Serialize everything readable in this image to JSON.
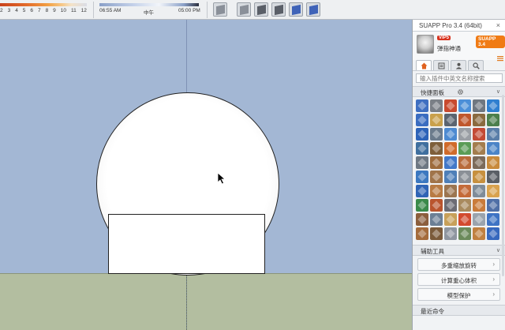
{
  "toolbar": {
    "months": [
      "2",
      "3",
      "4",
      "5",
      "6",
      "7",
      "8",
      "9",
      "10",
      "11",
      "12"
    ],
    "time_start": "06:55 AM",
    "time_mid": "中午",
    "time_end": "05:00 PM",
    "style_icons": [
      "xray-cube-icon",
      "wireframe-cube-icon",
      "hidden-line-cube-icon",
      "shaded-cube-icon",
      "shaded-texture-cube-icon",
      "monochrome-cube-icon"
    ]
  },
  "viewport": {
    "sky_color": "#a3b7d4",
    "ground_color": "#b3bea0",
    "model_color": "#ffffff"
  },
  "panel": {
    "title": "SUAPP Pro 3.4 (64bit)",
    "vip": "VIP5",
    "username": "弹指神通",
    "version": "SUAPP 3.4",
    "search_placeholder": "输入插件中英文名称搜索",
    "quick_panel_label": "快捷面板",
    "aux_tools_label": "辅助工具",
    "aux_buttons": [
      "多重缩放旋转",
      "计算重心体积",
      "模型保护"
    ],
    "recent_label": "最近命令",
    "tool_colors": [
      "#3f6fc1",
      "#7a7f86",
      "#c84a2f",
      "#4b8fd8",
      "#6f7780",
      "#2f7fd0",
      "#3a6cc0",
      "#c9a04b",
      "#5b6470",
      "#c0572d",
      "#8a6a3f",
      "#4c7f4c",
      "#2d63b8",
      "#6b7b8c",
      "#4d8ad1",
      "#9a9ea4",
      "#c34a35",
      "#5a7ea8",
      "#3f6f9e",
      "#7e5f3a",
      "#d06b2a",
      "#5a9c56",
      "#a37d4e",
      "#4b84c7",
      "#6d7782",
      "#9d6b3c",
      "#4278c8",
      "#b86a3a",
      "#7b6a5a",
      "#c88a3c",
      "#3c78c0",
      "#a0744a",
      "#4e7fb8",
      "#8a8f96",
      "#c7903f",
      "#5a5f66",
      "#2f64b5",
      "#b87b44",
      "#9b7550",
      "#c46a38",
      "#7f8c99",
      "#d9a24e",
      "#3a8a4a",
      "#b9542d",
      "#6c6c74",
      "#a88a5e",
      "#c97b3a",
      "#4f6fa6",
      "#8b5e3c",
      "#6b7f95",
      "#c7a05a",
      "#d24a2e",
      "#9aa3ad",
      "#3e73c4",
      "#a46b3b",
      "#7a5a3a",
      "#8f96a0",
      "#6b8a5a",
      "#c08040",
      "#3668bd"
    ]
  }
}
